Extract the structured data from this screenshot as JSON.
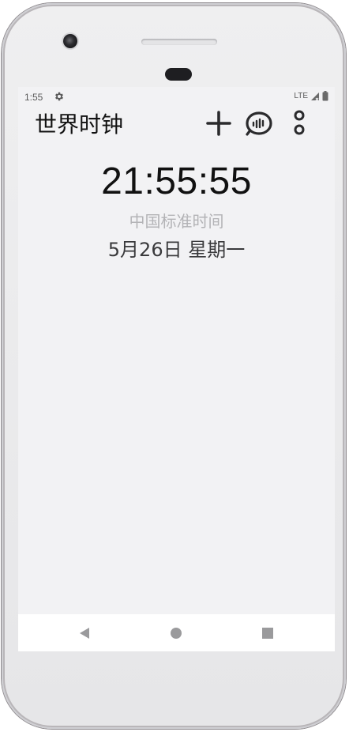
{
  "status_bar": {
    "time": "1:55",
    "network": "LTE",
    "icons": [
      "settings-icon",
      "signal-icon",
      "battery-icon"
    ]
  },
  "app_bar": {
    "title": "世界时钟",
    "actions": [
      "add-icon",
      "speech-bubble-icon",
      "more-options-icon"
    ]
  },
  "clock": {
    "time": "21:55:55",
    "zone": "中国标准时间",
    "date": "5月26日 星期一"
  },
  "nav_bar": {
    "buttons": [
      "back-icon",
      "home-icon",
      "recents-icon"
    ]
  },
  "colors": {
    "screen_background": "#f2f2f4",
    "primary_text": "#111111",
    "secondary_text": "#b3b3b6",
    "date_text": "#3a3a3c",
    "nav_icons": "#9a9a9c"
  }
}
